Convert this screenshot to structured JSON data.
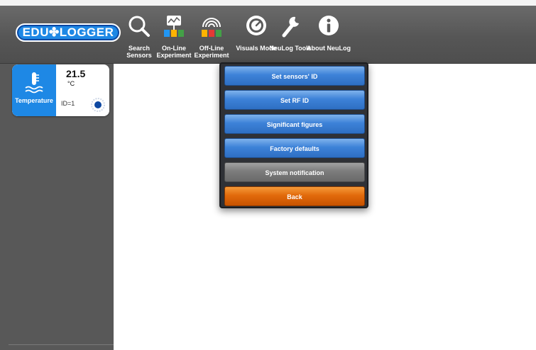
{
  "header": {
    "logo_text": "EDU✤LOGGER",
    "toolbar": [
      {
        "label": "Search Sensors",
        "icon": "magnifier-icon"
      },
      {
        "label": "On-Line Experiment",
        "icon": "online-experiment-icon"
      },
      {
        "label": "Off-Line Experiment",
        "icon": "offline-experiment-icon"
      },
      {
        "label": "Visuals Mode",
        "icon": "gauge-icon"
      },
      {
        "label": "NeuLog Tools",
        "icon": "wrench-icon"
      },
      {
        "label": "About NeuLog",
        "icon": "info-icon"
      }
    ]
  },
  "sensor": {
    "name": "Temperature",
    "value": "21.5",
    "unit": "°C",
    "id_label": "ID=1",
    "icon": "thermometer-icon",
    "color": "#1e88e5"
  },
  "tools_menu": {
    "items": [
      {
        "label": "Set sensors' ID",
        "style": "blue"
      },
      {
        "label": "Set RF ID",
        "style": "blue"
      },
      {
        "label": "Significant figures",
        "style": "blue"
      },
      {
        "label": "Factory defaults",
        "style": "blue"
      },
      {
        "label": "System notification",
        "style": "gray"
      },
      {
        "label": "Back",
        "style": "orange"
      }
    ]
  },
  "colors": {
    "toolbar": "#5a5a5a",
    "sidebar": "#585858",
    "accent_blue": "#3d82d8",
    "back_orange": "#e26a0b"
  }
}
